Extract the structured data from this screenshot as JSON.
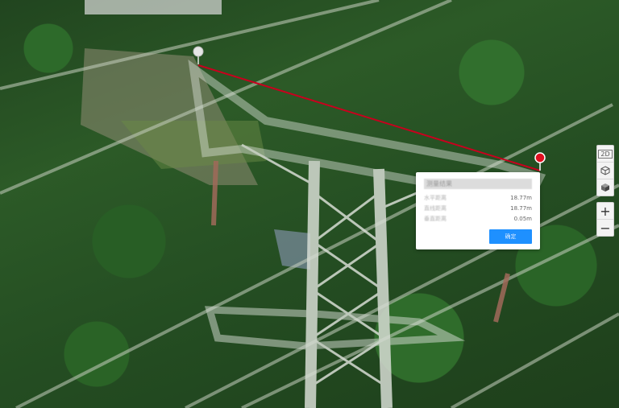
{
  "toolbar": {
    "view_2d_label": "2D",
    "view_3d_icon": "cube-icon",
    "view_solid_icon": "solid-cube-icon"
  },
  "zoom": {
    "in_label": "+",
    "out_label": "−"
  },
  "measurement": {
    "title": "测量结果",
    "rows": [
      {
        "label": "水平距离",
        "value": "18.77m"
      },
      {
        "label": "直线距离",
        "value": "18.77m"
      },
      {
        "label": "垂直距离",
        "value": "0.05m"
      }
    ],
    "confirm_label": "确定"
  },
  "colors": {
    "measure_line": "#c8001e",
    "end_marker": "#e01020",
    "start_marker": "#e6e6e6",
    "accent": "#1e90ff"
  }
}
